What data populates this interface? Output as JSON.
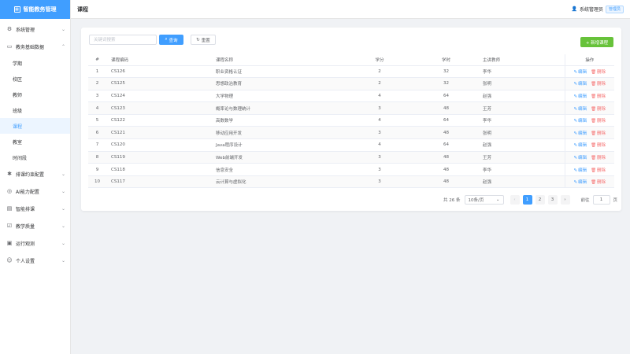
{
  "brand": {
    "title": "智能教务管理",
    "logo_icon": "grid-icon"
  },
  "header": {
    "title": "课程",
    "user_name": "系统管理员",
    "role": "管理员"
  },
  "sidebar": {
    "groups": [
      {
        "label": "系统管理",
        "icon": "gear-icon",
        "expanded": false
      },
      {
        "label": "教务基础数据",
        "icon": "monitor-icon",
        "expanded": true,
        "children": [
          "学期",
          "校区",
          "教师",
          "班级",
          "课程",
          "教室",
          "时间段"
        ]
      },
      {
        "label": "排课约束配置",
        "icon": "puzzle-icon",
        "expanded": false
      },
      {
        "label": "AI能力配置",
        "icon": "ai-icon",
        "expanded": false
      },
      {
        "label": "智能排课",
        "icon": "calendar-icon",
        "expanded": false
      },
      {
        "label": "教学质量",
        "icon": "checkbox-icon",
        "expanded": false
      },
      {
        "label": "运行观测",
        "icon": "screen-icon",
        "expanded": false
      },
      {
        "label": "个人设置",
        "icon": "user-icon",
        "expanded": false
      }
    ],
    "active_child": "课程"
  },
  "toolbar": {
    "search_placeholder": "关键词搜索",
    "query_label": "查询",
    "reset_label": "重置",
    "add_label": "+ 新增课程"
  },
  "table": {
    "headers": [
      "#",
      "课程编码",
      "课程名称",
      "学分",
      "学时",
      "主讲教师",
      "操作"
    ],
    "edit_label": "编辑",
    "delete_label": "删除",
    "rows": [
      [
        "1",
        "CS126",
        "职业资格认证",
        "2",
        "32",
        "李华"
      ],
      [
        "2",
        "CS125",
        "思想政治教育",
        "2",
        "32",
        "张明"
      ],
      [
        "3",
        "CS124",
        "大学物理",
        "4",
        "64",
        "赵强"
      ],
      [
        "4",
        "CS123",
        "概率论与数理统计",
        "3",
        "48",
        "王芳"
      ],
      [
        "5",
        "CS122",
        "高数数学",
        "4",
        "64",
        "李华"
      ],
      [
        "6",
        "CS121",
        "移动应用开发",
        "3",
        "48",
        "张明"
      ],
      [
        "7",
        "CS120",
        "Java程序设计",
        "4",
        "64",
        "赵强"
      ],
      [
        "8",
        "CS119",
        "Web前端开发",
        "3",
        "48",
        "王芳"
      ],
      [
        "9",
        "CS118",
        "信息安全",
        "3",
        "48",
        "李华"
      ],
      [
        "10",
        "CS117",
        "云计算与虚拟化",
        "3",
        "48",
        "赵强"
      ]
    ]
  },
  "pagination": {
    "total_text": "共 26 条",
    "page_size": "10条/页",
    "pages": [
      "1",
      "2",
      "3"
    ],
    "current": "1",
    "goto_label": "前往",
    "goto_value": "1",
    "page_unit": "页"
  },
  "colors": {
    "primary": "#409eff",
    "success": "#67c23a",
    "danger": "#f56c6c"
  }
}
